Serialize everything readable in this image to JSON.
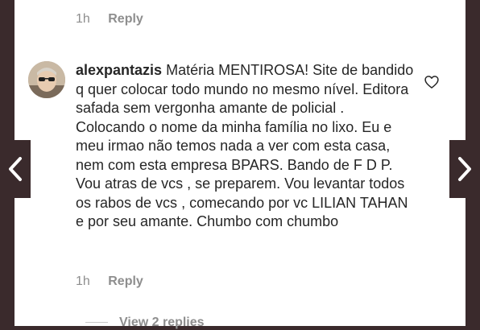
{
  "top_comment": {
    "time": "1h",
    "reply_label": "Reply"
  },
  "comment": {
    "username": "alexpantazis",
    "text": "Matéria MENTIROSA! Site de bandido q quer colocar todo mundo no mesmo nível. Editora safada sem vergonha amante de policial . Colocando o nome da minha família no lixo. Eu e meu irmao não temos nada a ver com esta casa, nem com esta empresa BPARS. Bando de F D P. Vou atras de vcs , se preparem. Vou levantar todos os rabos de vcs , comecando por vc LILIAN TAHAN e por seu amante. Chumbo com chumbo",
    "time": "1h",
    "reply_label": "Reply"
  },
  "view_replies_label": "View 2 replies",
  "icons": {
    "heart": "heart-icon",
    "prev": "chevron-left-icon",
    "next": "chevron-right-icon"
  }
}
